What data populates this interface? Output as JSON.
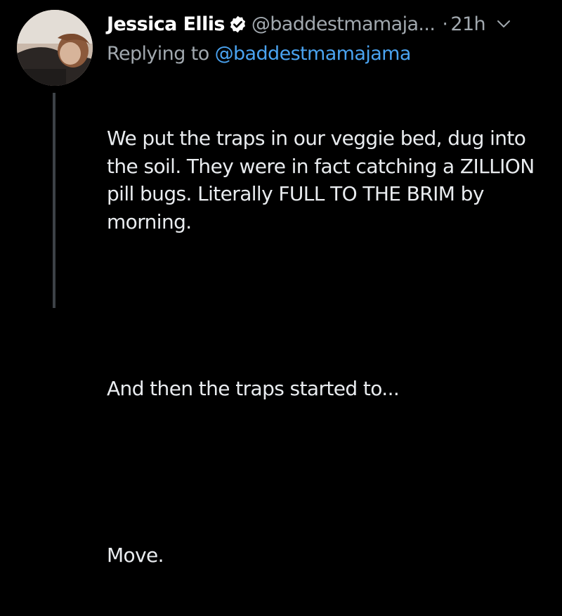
{
  "tweet": {
    "author_name": "Jessica Ellis",
    "handle": "@baddestmamaja...",
    "separator": "·",
    "time": "21h",
    "reply_prefix": "Replying to ",
    "reply_to": "@baddestmamajama",
    "paragraphs": [
      "We put the traps in our veggie bed, dug into the soil. They were in fact catching a ZILLION pill bugs. Literally FULL TO THE BRIM by morning.",
      "And then the traps started to...",
      "Move."
    ]
  },
  "icons": {
    "verified": "verified-badge-icon",
    "menu": "chevron-down-icon"
  },
  "colors": {
    "background": "#000000",
    "primary_text": "#e9ecef",
    "secondary_text": "#a1a8ae",
    "link": "#4aa3f0",
    "thread_line": "#3d4247"
  }
}
